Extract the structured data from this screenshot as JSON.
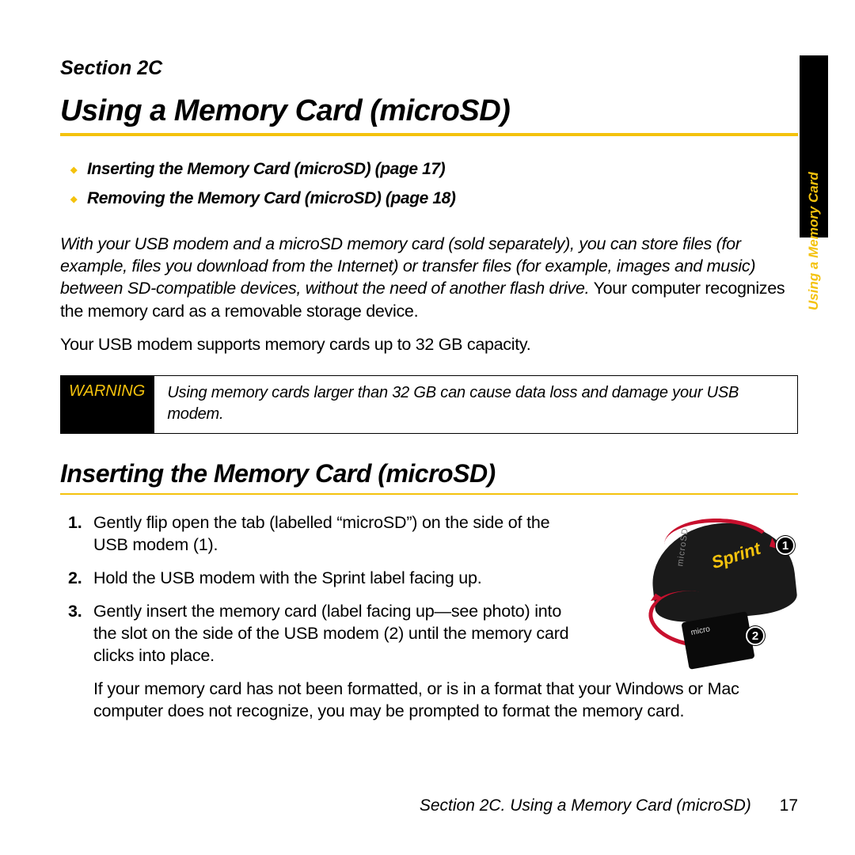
{
  "side_tab": "Using a Memory Card",
  "section_label": "Section 2C",
  "h1": "Using a Memory Card (microSD)",
  "toc": [
    "Inserting the Memory Card (microSD) (page 17)",
    "Removing the Memory Card (microSD) (page 18)"
  ],
  "intro_italic": "With your USB modem and a microSD memory card (sold separately), you can store files (for example, files you download from the Internet) or transfer files (for example, images and music) between SD-compatible devices, without the need of another flash drive.",
  "intro_rest": " Your computer recognizes the memory card as a removable storage device.",
  "capacity": "Your USB modem supports memory cards up to 32 GB capacity.",
  "warning_label": "WARNING",
  "warning_text": "Using memory cards larger than 32 GB can cause data loss and damage your USB modem.",
  "h2": "Inserting the Memory Card (microSD)",
  "steps": {
    "s1": "Gently flip open the tab (labelled “microSD”) on the side of the USB modem (1).",
    "s2": "Hold the USB modem with the Sprint label facing up.",
    "s3": "Gently insert the memory card (label facing up—see photo) into the slot on the side of the USB modem (2) until the memory card clicks into place.",
    "s4": "If your memory card has not been formatted, or is in a format that your Windows or Mac computer does not recognize, you may be prompted to format the memory card."
  },
  "illus": {
    "brand": "Sprint",
    "slot_label": "microSD",
    "callout1": "1",
    "callout2": "2"
  },
  "footer_text": "Section 2C. Using a Memory Card (microSD)",
  "footer_page": "17"
}
